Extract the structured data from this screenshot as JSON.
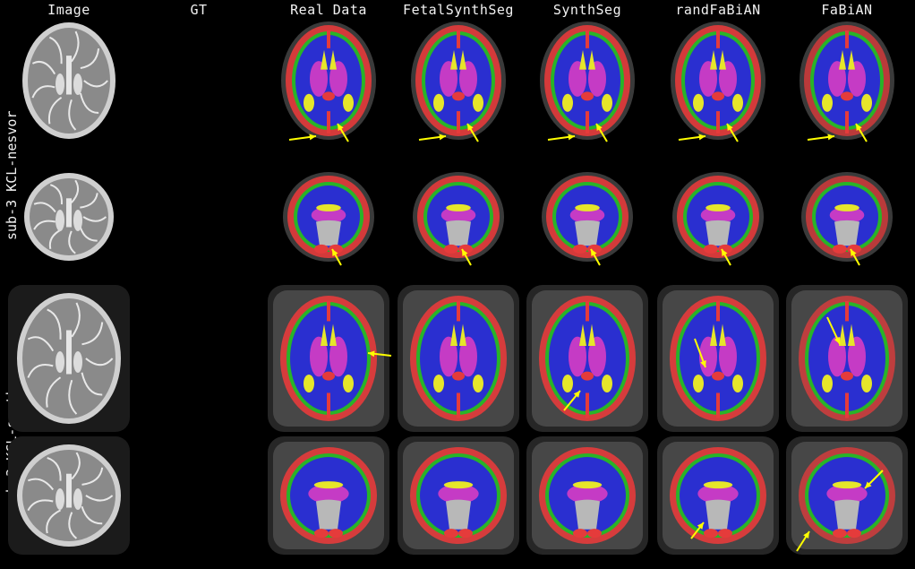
{
  "headers": {
    "image": "Image",
    "gt": "GT",
    "real_data": "Real Data",
    "fetal_synth_seg": "FetalSynthSeg",
    "synth_seg": "SynthSeg",
    "rand_fabian": "randFaBiAN",
    "fabian": "FaBiAN"
  },
  "row_labels": {
    "group1": "sub-3 KCL-nesvor",
    "group2": "sub-3 KCL-svrtk"
  },
  "colors": {
    "background": "#000000",
    "cortex": "#e53b3b",
    "white_matter": "#2a2fd0",
    "deep_gray": "#c53bc5",
    "ventricles": "#e6e62a",
    "boundary": "#28b428",
    "brainstem": "#b8b8b8",
    "arrow": "#ffff00"
  }
}
